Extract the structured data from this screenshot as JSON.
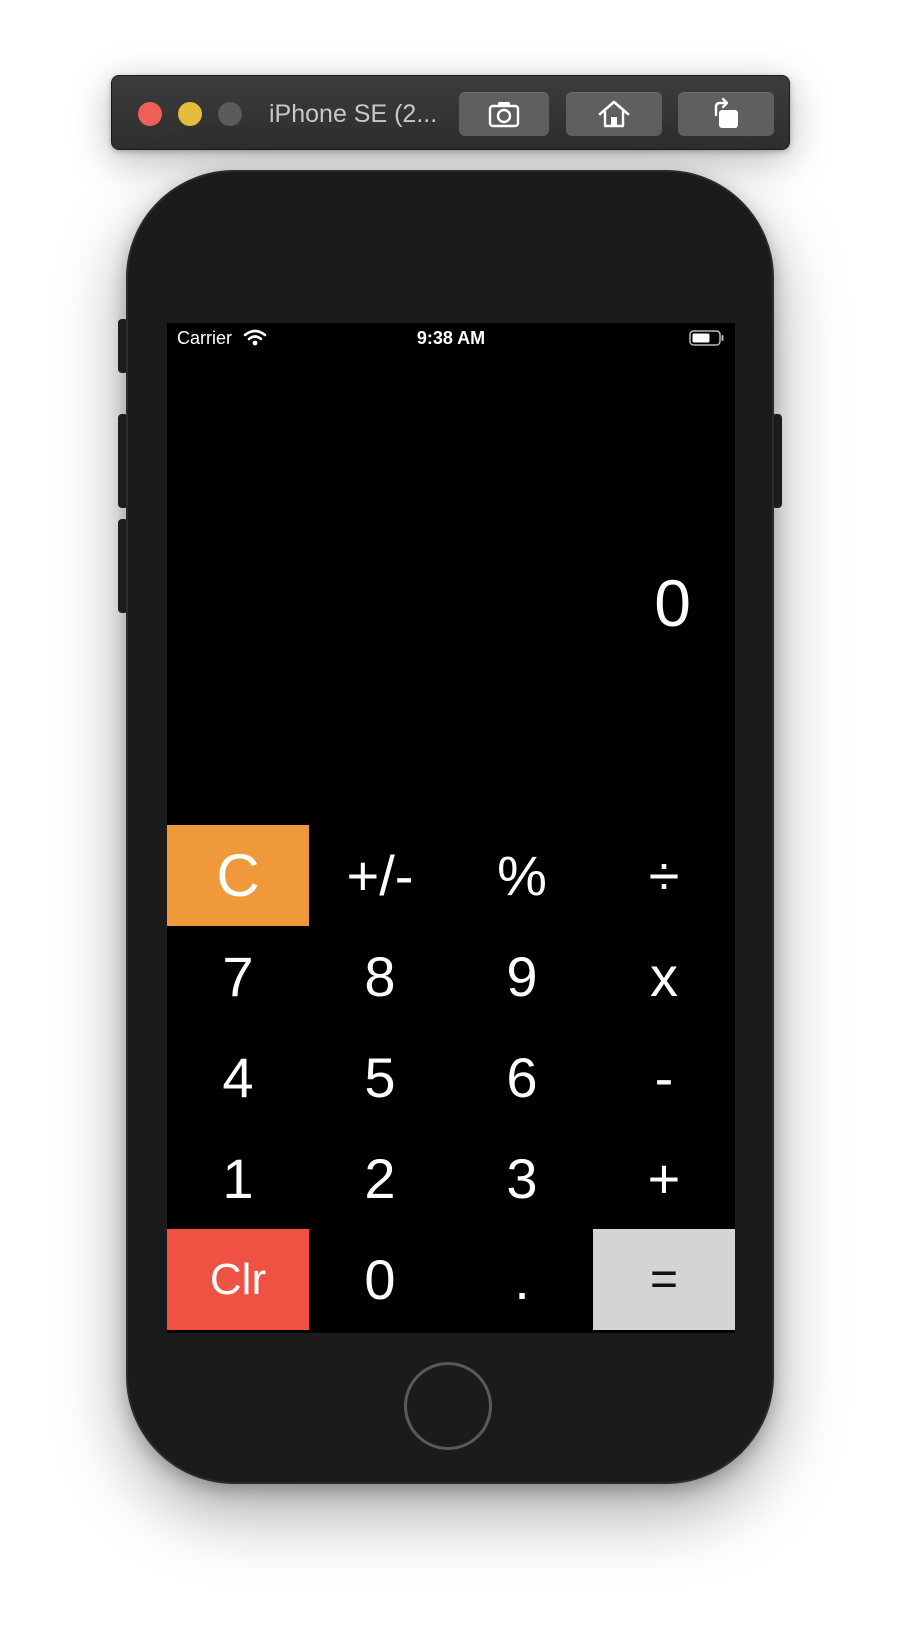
{
  "window": {
    "title": "iPhone SE (2...",
    "toolbar_icons": [
      "screenshot-icon",
      "home-icon",
      "rotate-icon"
    ]
  },
  "status_bar": {
    "carrier": "Carrier",
    "time": "9:38 AM"
  },
  "display": {
    "value": "0"
  },
  "keypad": {
    "rows": [
      [
        "C",
        "+/-",
        "%",
        "÷"
      ],
      [
        "7",
        "8",
        "9",
        "x"
      ],
      [
        "4",
        "5",
        "6",
        "-"
      ],
      [
        "1",
        "2",
        "3",
        "+"
      ],
      [
        "Clr",
        "0",
        ".",
        "="
      ]
    ]
  },
  "colors": {
    "clear_key": "#f0993a",
    "clr_key": "#ef5143",
    "equals_key": "#d4d4d4",
    "screen_background": "#000000"
  }
}
